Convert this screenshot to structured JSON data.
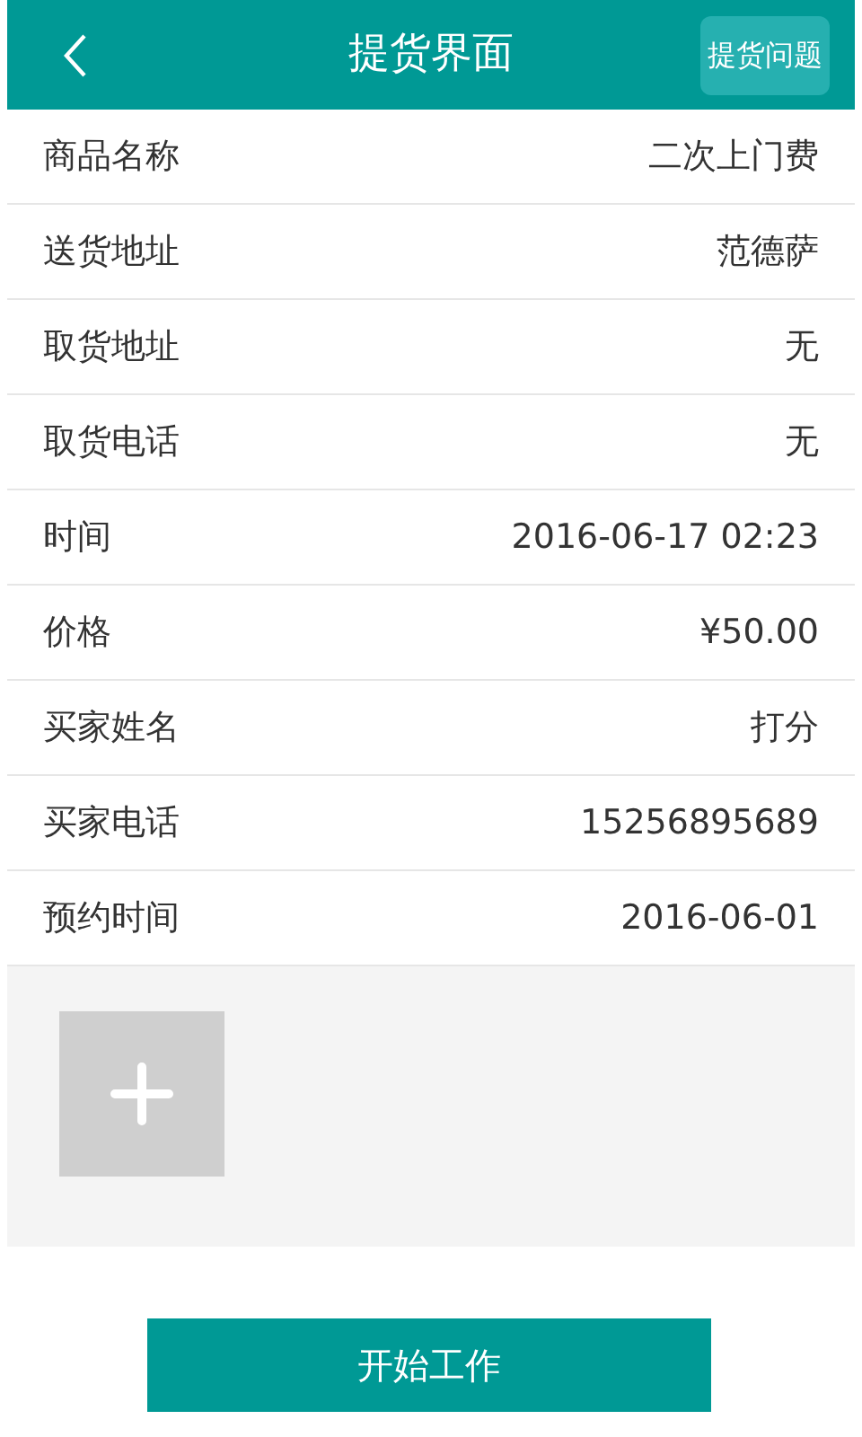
{
  "header": {
    "title": "提货界面",
    "action": "提货问题"
  },
  "fields": [
    {
      "label": "商品名称",
      "value": "二次上门费"
    },
    {
      "label": "送货地址",
      "value": "范德萨"
    },
    {
      "label": "取货地址",
      "value": "无"
    },
    {
      "label": "取货电话",
      "value": "无"
    },
    {
      "label": "时间",
      "value": "2016-06-17 02:23"
    },
    {
      "label": "价格",
      "value": "¥50.00"
    },
    {
      "label": "买家姓名",
      "value": "打分"
    },
    {
      "label": "买家电话",
      "value": "15256895689"
    },
    {
      "label": "预约时间",
      "value": "2016-06-01"
    }
  ],
  "start_button": "开始工作"
}
